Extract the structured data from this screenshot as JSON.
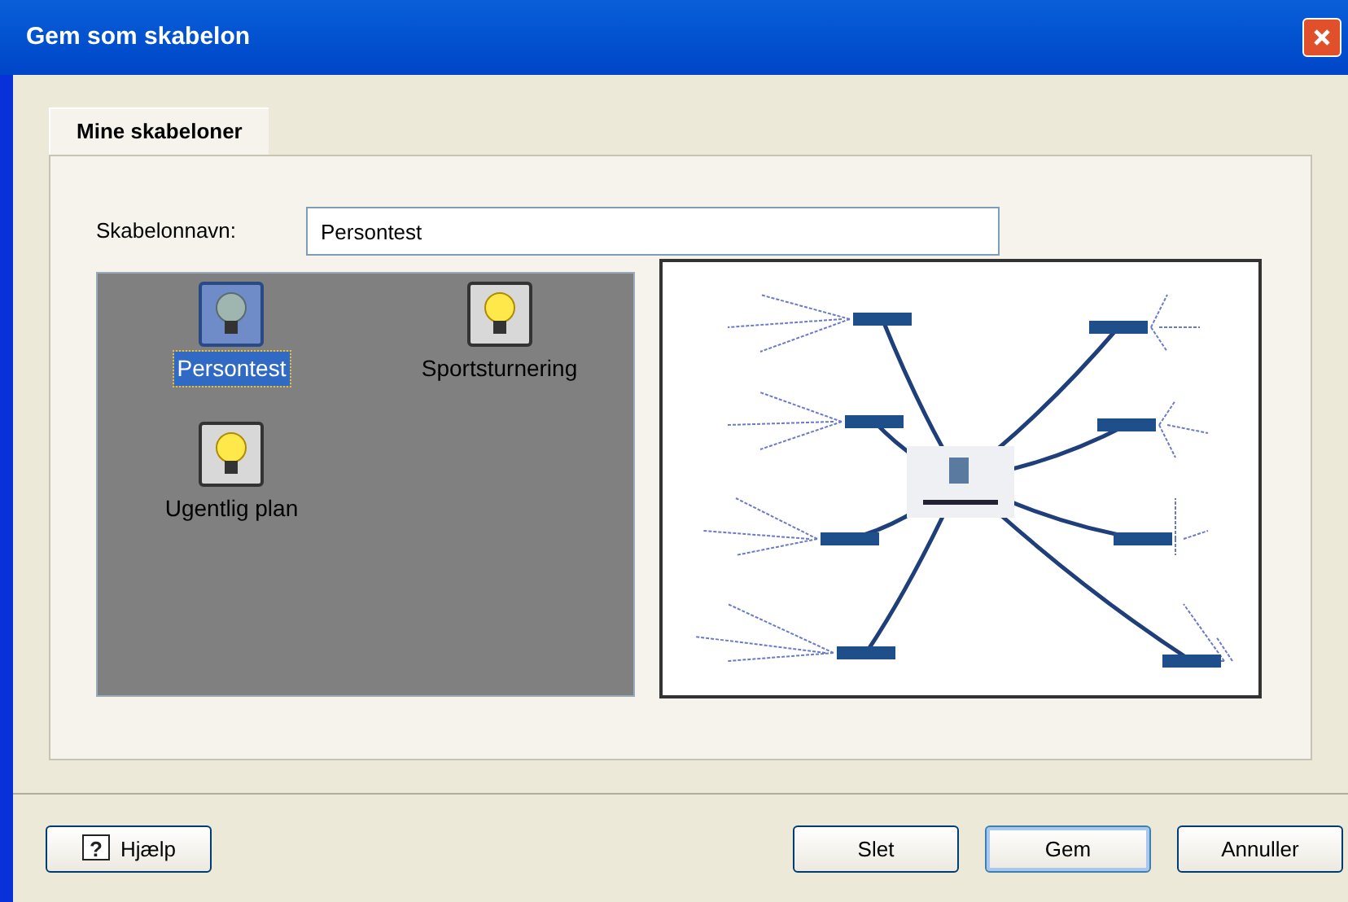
{
  "window": {
    "title": "Gem som skabelon"
  },
  "tabs": [
    {
      "label": "Mine skabeloner",
      "selected": true
    }
  ],
  "name_field": {
    "label": "Skabelonnavn:",
    "value": "Persontest"
  },
  "templates": [
    {
      "name": "Persontest",
      "selected": true
    },
    {
      "name": "Sportsturnering",
      "selected": false
    },
    {
      "name": "Ugentlig plan",
      "selected": false
    }
  ],
  "buttons": [
    {
      "label": "Hjælp",
      "kind": "help",
      "default": false,
      "icon_glyph": "?"
    },
    {
      "label": "Slet",
      "kind": "plain",
      "default": false
    },
    {
      "label": "Gem",
      "kind": "plain",
      "default": true
    },
    {
      "label": "Annuller",
      "kind": "plain",
      "default": false
    }
  ]
}
